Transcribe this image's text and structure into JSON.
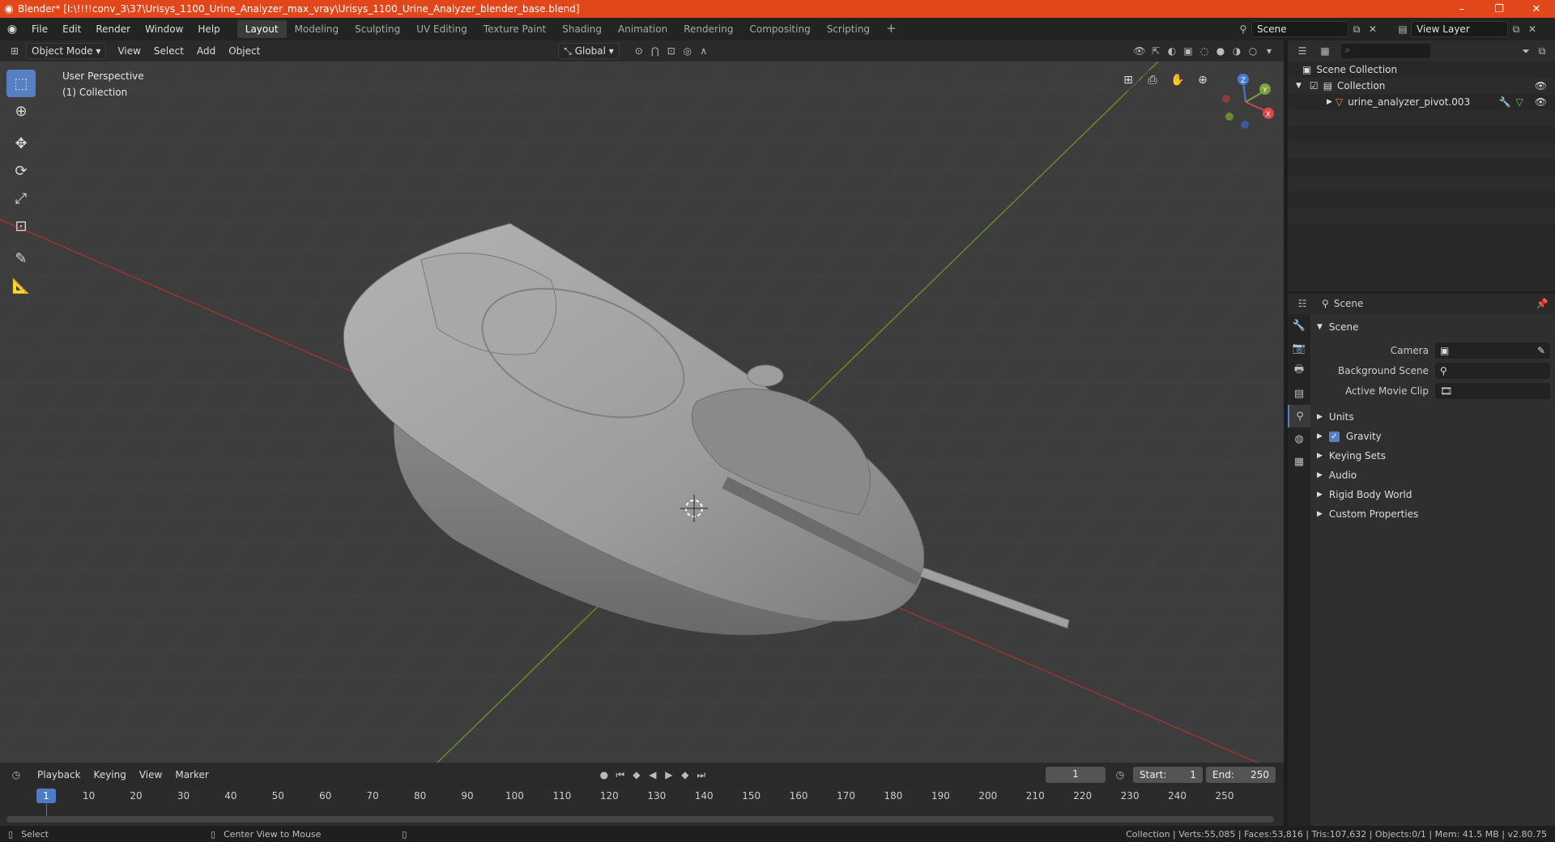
{
  "window": {
    "title": "Blender* [I:\\!!!!conv_3\\37\\Urisys_1100_Urine_Analyzer_max_vray\\Urisys_1100_Urine_Analyzer_blender_base.blend]",
    "minimize": "–",
    "maximize": "❐",
    "close": "✕"
  },
  "menu": [
    "File",
    "Edit",
    "Render",
    "Window",
    "Help"
  ],
  "workspaces": [
    "Layout",
    "Modeling",
    "Sculpting",
    "UV Editing",
    "Texture Paint",
    "Shading",
    "Animation",
    "Rendering",
    "Compositing",
    "Scripting"
  ],
  "workspace_add": "+",
  "scene_name": "Scene",
  "view_layer": "View Layer",
  "viewport_header": {
    "mode": "Object Mode",
    "menus": [
      "View",
      "Select",
      "Add",
      "Object"
    ],
    "orientation": "Global"
  },
  "viewport": {
    "view_name": "User Perspective",
    "collection": "(1) Collection",
    "gizmo_x": "X",
    "gizmo_y": "Y",
    "gizmo_z": "Z"
  },
  "timeline": {
    "menus": [
      "Playback",
      "Keying",
      "View",
      "Marker"
    ],
    "current_frame": "1",
    "start_label": "Start:",
    "start": "1",
    "end_label": "End:",
    "end": "250",
    "ticks": [
      "1",
      "10",
      "20",
      "30",
      "40",
      "50",
      "60",
      "70",
      "80",
      "90",
      "100",
      "110",
      "120",
      "130",
      "140",
      "150",
      "160",
      "170",
      "180",
      "190",
      "200",
      "210",
      "220",
      "230",
      "240",
      "250"
    ]
  },
  "statusbar": {
    "select": "Select",
    "center_view": "Center View to Mouse",
    "stats": "Collection | Verts:55,085 | Faces:53,816 | Tris:107,632 | Objects:0/1 | Mem: 41.5 MB | v2.80.75"
  },
  "outliner": {
    "scene_collection": "Scene Collection",
    "collection": "Collection",
    "object": "urine_analyzer_pivot.003"
  },
  "properties": {
    "header": "Scene",
    "section": "Scene",
    "fields": [
      {
        "label": "Camera",
        "value": ""
      },
      {
        "label": "Background Scene",
        "value": ""
      },
      {
        "label": "Active Movie Clip",
        "value": ""
      }
    ],
    "subsections": [
      "Units",
      "Gravity",
      "Keying Sets",
      "Audio",
      "Rigid Body World",
      "Custom Properties"
    ]
  }
}
